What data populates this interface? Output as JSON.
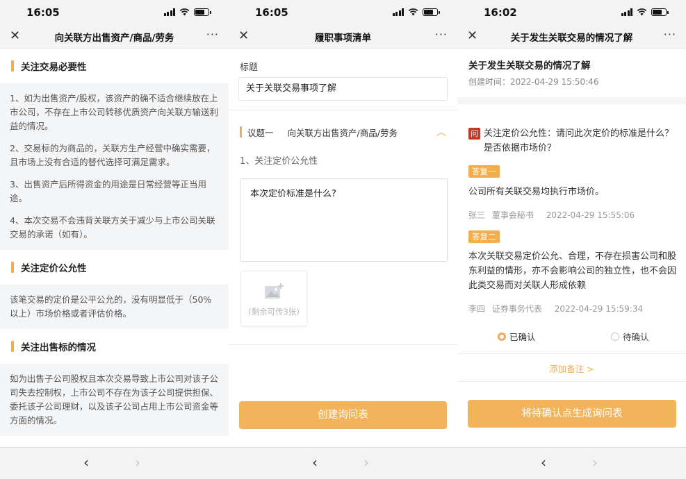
{
  "status": {
    "time1": "16:05",
    "time2": "16:05",
    "time3": "16:02"
  },
  "screens": [
    {
      "title": "向关联方出售资产/商品/劳务",
      "sections": [
        {
          "heading": "关注交易必要性",
          "paragraphs": [
            "1、如为出售资产/股权，该资产的确不适合继续放在上市公司，不存在上市公司转移优质资产向关联方输送利益的情况。",
            "2、交易标的为商品的，关联方生产经营中确实需要，且市场上没有合适的替代选择可满足需求。",
            "3、出售资产后所得资金的用途是日常经营等正当用途。",
            "4、本次交易不会违背关联方关于减少与上市公司关联交易的承诺（如有）。"
          ]
        },
        {
          "heading": "关注定价公允性",
          "paragraphs": [
            "该笔交易的定价是公平公允的，没有明显低于（50%以上）市场价格或者评估价格。"
          ]
        },
        {
          "heading": "关注出售标的情况",
          "paragraphs": [
            "如为出售子公司股权且本次交易导致上市公司对该子公司失去控制权，上市公司不存在为该子公司提供担保、委托该子公司理财，以及该子公司占用上市公司资金等方面的情况。"
          ]
        }
      ]
    },
    {
      "title": "履职事项清单",
      "field_label": "标题",
      "field_value": "关于关联交易事项了解",
      "issue_num": "议题一",
      "issue_name": "向关联方出售资产/商品/劳务",
      "question_label": "1、关注定价公允性",
      "question_text": "本次定价标准是什么?",
      "upload_hint": "(剩余可传3张)",
      "button": "创建询问表"
    },
    {
      "title": "关于发生关联交易的情况了解",
      "heading": "关于发生关联交易的情况了解",
      "created": "创建时间：2022-04-29 15:50:46",
      "q_icon": "问",
      "question": "关注定价公允性：请问此次定价的标准是什么？是否依据市场价？",
      "replies": [
        {
          "tag": "答复一",
          "text": "公司所有关联交易均执行市场价。",
          "name": "张三",
          "role": "董事会秘书",
          "time": "2022-04-29 15:55:06"
        },
        {
          "tag": "答复二",
          "text": "本次关联交易定价公允、合理，不存在损害公司和股东利益的情形，亦不会影响公司的独立性，也不会因此类交易而对关联人形成依赖",
          "name": "李四",
          "role": "证券事务代表",
          "time": "2022-04-29 15:59:34"
        }
      ],
      "opt_confirmed": "已确认",
      "opt_pending": "待确认",
      "selected_option": "已确认",
      "add_note": "添加备注 >",
      "button": "将待确认点生成询问表"
    }
  ],
  "nav": {
    "close": "✕",
    "more": "···",
    "back": "‹",
    "forward": "›"
  },
  "colors": {
    "accent": "#f2ad4e",
    "button": "#f2b35b",
    "question_icon": "#c0392b",
    "panel": "#f4f5f7"
  }
}
